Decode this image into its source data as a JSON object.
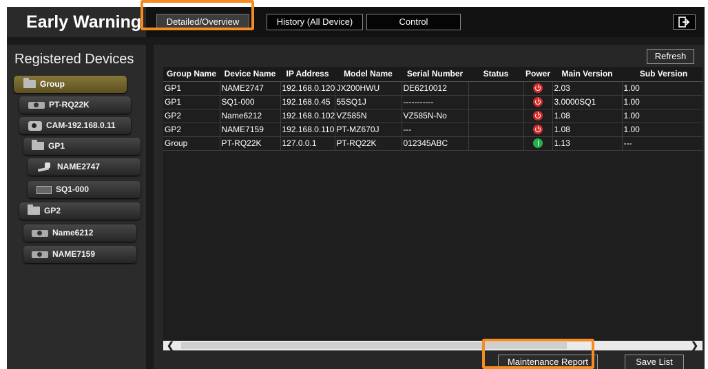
{
  "app_title": "Early Warning",
  "tabs": {
    "detailed": "Detailed/Overview",
    "history": "History (All Device)",
    "control": "Control"
  },
  "sidebar": {
    "title": "Registered Devices",
    "items": [
      {
        "label": "Group",
        "icon": "folder-icon"
      },
      {
        "label": "PT-RQ22K",
        "icon": "projector-icon"
      },
      {
        "label": "CAM-192.168.0.11",
        "icon": "camera-icon"
      },
      {
        "label": "GP1",
        "icon": "folder-icon"
      },
      {
        "label": "NAME2747",
        "icon": "ptz-camera-icon"
      },
      {
        "label": "SQ1-000",
        "icon": "display-icon"
      },
      {
        "label": "GP2",
        "icon": "folder-icon"
      },
      {
        "label": "Name6212",
        "icon": "projector-icon"
      },
      {
        "label": "NAME7159",
        "icon": "projector-icon"
      }
    ]
  },
  "toolbar": {
    "refresh": "Refresh"
  },
  "table": {
    "columns": [
      "Group Name",
      "Device Name",
      "IP Address",
      "Model Name",
      "Serial Number",
      "Status",
      "Power",
      "Main Version",
      "Sub Version"
    ],
    "rows": [
      [
        "GP1",
        "NAME2747",
        "192.168.0.120",
        "JX200HWU",
        "DE6210012",
        "",
        "off",
        "2.03",
        "1.00"
      ],
      [
        "GP1",
        "SQ1-000",
        "192.168.0.45",
        "55SQ1J",
        "-----------",
        "",
        "off",
        "3.0000SQ1",
        "1.00"
      ],
      [
        "GP2",
        "Name6212",
        "192.168.0.102",
        "VZ585N",
        "VZ585N-No",
        "",
        "off",
        "1.08",
        "1.00"
      ],
      [
        "GP2",
        "NAME7159",
        "192.168.0.110",
        "PT-MZ670J",
        "---",
        "",
        "off",
        "1.08",
        "1.00"
      ],
      [
        "Group",
        "PT-RQ22K",
        "127.0.0.1",
        "PT-RQ22K",
        "012345ABC",
        "",
        "on",
        "1.13",
        "---"
      ]
    ]
  },
  "footer": {
    "maintenance_report": "Maintenance Report",
    "save_list": "Save List"
  },
  "colors": {
    "highlight": "#f68b1f",
    "power_off": "#d62a2a",
    "power_on": "#22b14c",
    "selected_item": "#7a6a30"
  }
}
